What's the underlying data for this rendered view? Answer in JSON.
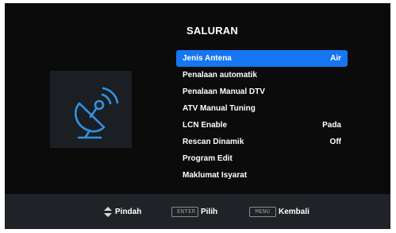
{
  "menu": {
    "title": "SALURAN",
    "items": [
      {
        "label": "Jenis Antena",
        "value": "Air",
        "selected": true
      },
      {
        "label": "Penalaan automatik",
        "value": ""
      },
      {
        "label": "Penalaan Manual DTV",
        "value": ""
      },
      {
        "label": "ATV Manual Tuning",
        "value": ""
      },
      {
        "label": "LCN Enable",
        "value": "Pada"
      },
      {
        "label": "Rescan Dinamik",
        "value": "Off"
      },
      {
        "label": "Program Edit",
        "value": ""
      },
      {
        "label": "Maklumat Isyarat",
        "value": ""
      }
    ]
  },
  "icon": {
    "name": "satellite-dish-icon",
    "color": "#2f93e6"
  },
  "colors": {
    "highlight": "#1675f0",
    "background": "#0b0b0b",
    "footer": "#1f2226",
    "icon_panel": "#1b1e22"
  },
  "footer": {
    "move_label": "Pindah",
    "enter_key": "ENTER",
    "enter_label": "Pilih",
    "menu_key": "MENU",
    "back_label": "Kembali"
  }
}
